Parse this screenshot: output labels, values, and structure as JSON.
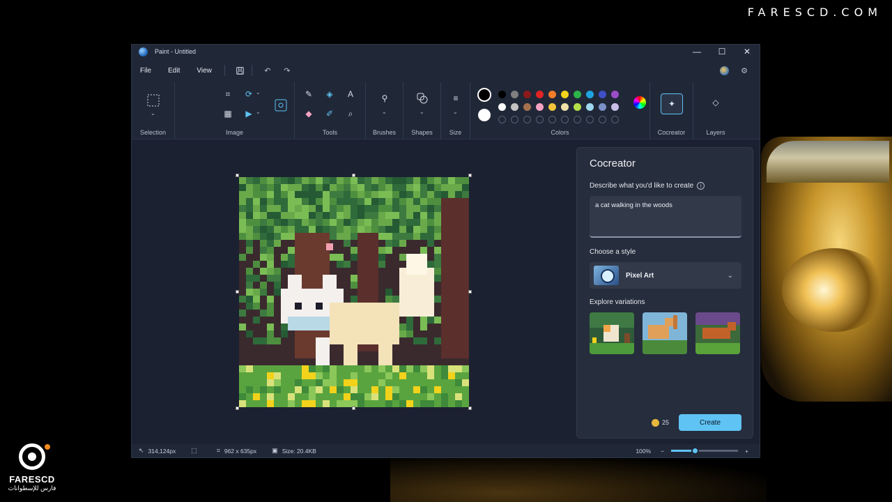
{
  "watermark": {
    "site": "FARESCD.COM",
    "logo_name": "FARESCD",
    "logo_sub": "فارس للإسطوانات"
  },
  "window": {
    "title": "Paint - Untitled",
    "controls": {
      "minimize": "—",
      "maximize": "☐",
      "close": "✕"
    }
  },
  "menu": {
    "file": "File",
    "edit": "Edit",
    "view": "View"
  },
  "ribbon": {
    "selection": "Selection",
    "image": "Image",
    "tools": "Tools",
    "brushes": "Brushes",
    "shapes": "Shapes",
    "size": "Size",
    "colors": "Colors",
    "cocreator": "Cocreator",
    "layers": "Layers",
    "palette_row1": [
      "#000000",
      "#7f7f7f",
      "#8b1a1a",
      "#e02424",
      "#f57c2a",
      "#f2d21b",
      "#2db34a",
      "#1fa3e0",
      "#3f4fc7",
      "#9b4cc8"
    ],
    "palette_row2": [
      "#ffffff",
      "#c3c3c3",
      "#a5714d",
      "#f5a3c2",
      "#f2c43a",
      "#efe1a6",
      "#b4e04a",
      "#9fd7ee",
      "#7b91c9",
      "#c8bfe7"
    ],
    "primary_color": "#000000",
    "secondary_color": "#ffffff"
  },
  "cocreator": {
    "title": "Cocreator",
    "describe_label": "Describe what you'd like to create",
    "prompt": "a cat walking in the woods",
    "style_label": "Choose a style",
    "style_value": "Pixel Art",
    "variations_label": "Explore variations",
    "credits": "25",
    "create_label": "Create"
  },
  "status": {
    "cursor": "314,124px",
    "canvas_size": "962  x  635px",
    "file_size": "Size: 20.4KB",
    "zoom": "100%",
    "zoom_level": 0.35
  }
}
